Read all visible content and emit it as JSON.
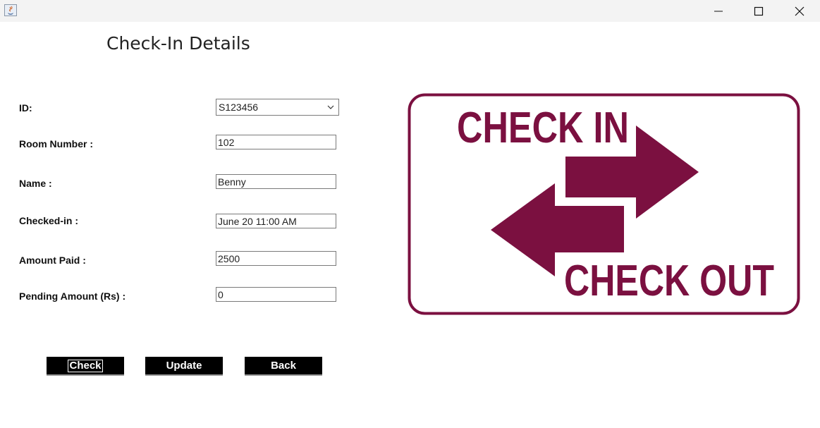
{
  "header": {
    "title": "Check-In Details"
  },
  "form": {
    "fields": [
      {
        "label": "ID:",
        "value": "S123456",
        "type": "select"
      },
      {
        "label": "Room Number :",
        "value": "102"
      },
      {
        "label": "Name :",
        "value": "Benny"
      },
      {
        "label": "Checked-in :",
        "value": "June 20 11:00 AM"
      },
      {
        "label": "Amount Paid :",
        "value": "2500"
      },
      {
        "label": "Pending Amount (Rs) :",
        "value": "0"
      }
    ]
  },
  "buttons": {
    "check": "Check",
    "update": "Update",
    "back": "Back"
  },
  "image": {
    "text_top": "CHECK IN",
    "text_bottom": "CHECK OUT",
    "color": "#7b1040"
  },
  "icons": {
    "app": "java-icon",
    "minimize": "minimize-icon",
    "maximize": "maximize-icon",
    "close": "close-icon",
    "dropdown": "chevron-down-icon"
  }
}
